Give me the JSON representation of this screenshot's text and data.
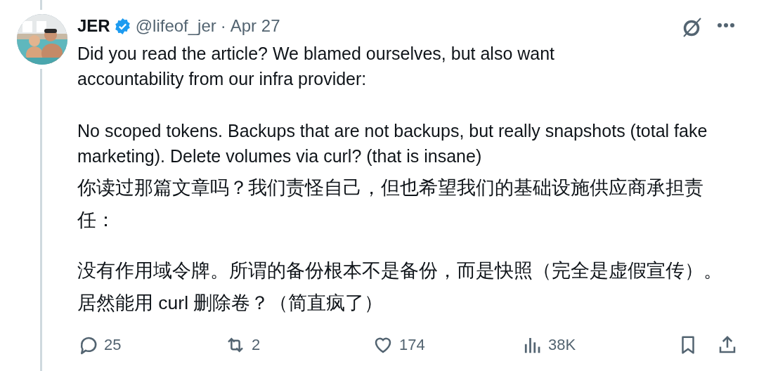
{
  "author": {
    "name": "JER",
    "verified": true,
    "handle": "@lifeof_jer",
    "separator": "·",
    "date": "Apr 27"
  },
  "paragraphs": [
    "Did you read the article? We blamed ourselves, but also want accountability from our infra provider:",
    "No scoped tokens. Backups that are not backups, but really snapshots (total fake marketing). Delete volumes via curl? (that is insane)",
    "你读过那篇文章吗？我们责怪自己，但也希望我们的基础设施供应商承担责任：",
    "没有作用域令牌。所谓的备份根本不是备份，而是快照（完全是虚假宣传）。居然能用 curl 删除卷？（简直疯了）"
  ],
  "actions": [
    {
      "kind": "reply",
      "count": "25"
    },
    {
      "kind": "repost",
      "count": "2"
    },
    {
      "kind": "like",
      "count": "174"
    },
    {
      "kind": "views",
      "count": "38K"
    },
    {
      "kind": "bookmark"
    },
    {
      "kind": "share"
    }
  ]
}
